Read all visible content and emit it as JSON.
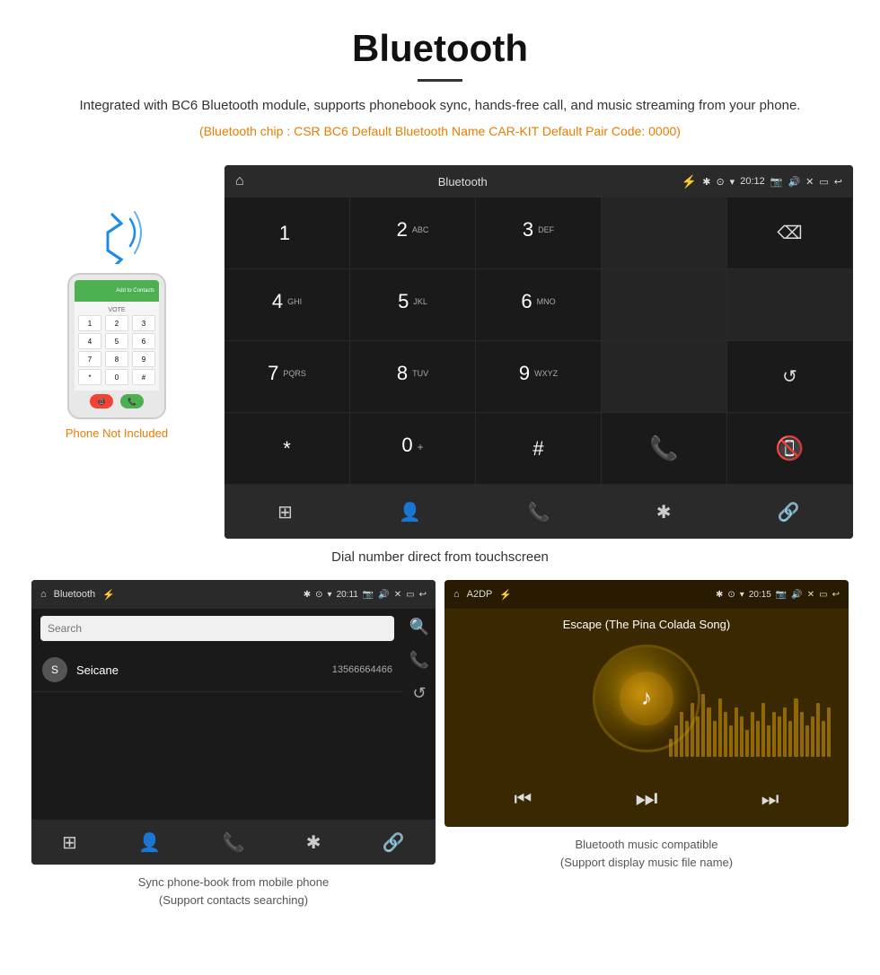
{
  "header": {
    "title": "Bluetooth",
    "description": "Integrated with BC6 Bluetooth module, supports phonebook sync, hands-free call, and music streaming from your phone.",
    "specs": "(Bluetooth chip : CSR BC6    Default Bluetooth Name CAR-KIT    Default Pair Code: 0000)"
  },
  "phone_illustration": {
    "not_included_label": "Phone Not Included",
    "add_contacts_label": "Add to Contacts",
    "dial_keys": [
      "1",
      "2",
      "3",
      "4",
      "5",
      "6",
      "*",
      "0",
      "+",
      "#"
    ]
  },
  "dial_screen": {
    "status": {
      "title": "Bluetooth",
      "time": "20:12"
    },
    "keys": [
      {
        "main": "1",
        "sub": ""
      },
      {
        "main": "2",
        "sub": "ABC"
      },
      {
        "main": "3",
        "sub": "DEF"
      },
      {
        "main": "",
        "sub": ""
      },
      {
        "main": "⌫",
        "sub": ""
      },
      {
        "main": "4",
        "sub": "GHI"
      },
      {
        "main": "5",
        "sub": "JKL"
      },
      {
        "main": "6",
        "sub": "MNO"
      },
      {
        "main": "",
        "sub": ""
      },
      {
        "main": "",
        "sub": ""
      },
      {
        "main": "7",
        "sub": "PQRS"
      },
      {
        "main": "8",
        "sub": "TUV"
      },
      {
        "main": "9",
        "sub": "WXYZ"
      },
      {
        "main": "",
        "sub": ""
      },
      {
        "main": "↺",
        "sub": ""
      },
      {
        "main": "*",
        "sub": ""
      },
      {
        "main": "0",
        "sub": "+"
      },
      {
        "main": "#",
        "sub": ""
      },
      {
        "main": "📞",
        "sub": ""
      },
      {
        "main": "📵",
        "sub": ""
      }
    ],
    "nav_icons": [
      "⊞",
      "👤",
      "📞",
      "✱",
      "🔗"
    ]
  },
  "dial_caption": "Dial number direct from touchscreen",
  "phonebook_screen": {
    "status": {
      "title": "Bluetooth",
      "time": "20:11"
    },
    "search_placeholder": "Search",
    "contacts": [
      {
        "initial": "S",
        "name": "Seicane",
        "number": "13566664466"
      }
    ],
    "side_icons": [
      "🔍",
      "📞",
      "↺"
    ],
    "nav_icons": [
      "⊞",
      "👤",
      "📞",
      "✱",
      "🔗"
    ]
  },
  "phonebook_caption": {
    "line1": "Sync phone-book from mobile phone",
    "line2": "(Support contacts searching)"
  },
  "music_screen": {
    "status": {
      "title": "A2DP",
      "time": "20:15"
    },
    "song_title": "Escape (The Pina Colada Song)",
    "bar_heights": [
      20,
      35,
      50,
      40,
      60,
      45,
      70,
      55,
      40,
      65,
      50,
      35,
      55,
      45,
      30,
      50,
      40,
      60,
      35,
      50,
      45,
      55,
      40,
      65,
      50,
      35,
      45,
      60,
      40,
      55
    ],
    "controls": [
      "⏮",
      "⏭",
      "⏭"
    ]
  },
  "music_caption": {
    "line1": "Bluetooth music compatible",
    "line2": "(Support display music file name)"
  }
}
